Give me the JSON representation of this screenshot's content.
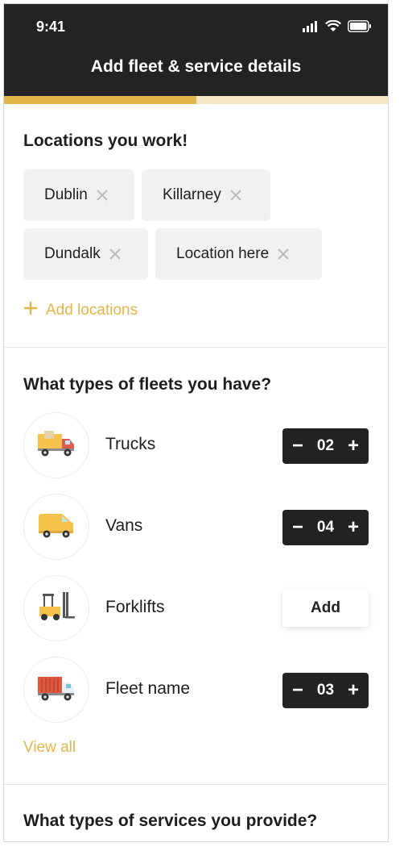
{
  "status_bar": {
    "time": "9:41",
    "icons": [
      "signal-icon",
      "wifi-icon",
      "battery-icon"
    ]
  },
  "header": {
    "title": "Add fleet & service details"
  },
  "progress": {
    "value": 0.5,
    "fill_color": "#e2b548",
    "track_color": "#f6e7c4"
  },
  "locations": {
    "title": "Locations you work!",
    "chips": [
      {
        "label": "Dublin"
      },
      {
        "label": "Killarney"
      },
      {
        "label": "Dundalk"
      },
      {
        "label": "Location here"
      }
    ],
    "add_label": "Add locations"
  },
  "fleets": {
    "title": "What types of fleets you have?",
    "items": [
      {
        "label": "Trucks",
        "count": "02",
        "icon": "truck-icon"
      },
      {
        "label": "Vans",
        "count": "04",
        "icon": "van-icon"
      },
      {
        "label": "Forklifts",
        "action_label": "Add",
        "icon": "forklift-icon"
      },
      {
        "label": "Fleet name",
        "count": "03",
        "icon": "cargo-truck-icon"
      }
    ],
    "view_all": "View all",
    "minus": "−",
    "plus": "+"
  },
  "services": {
    "title": "What types of services you provide?"
  },
  "colors": {
    "accent": "#e2b548",
    "dark": "#232323"
  }
}
